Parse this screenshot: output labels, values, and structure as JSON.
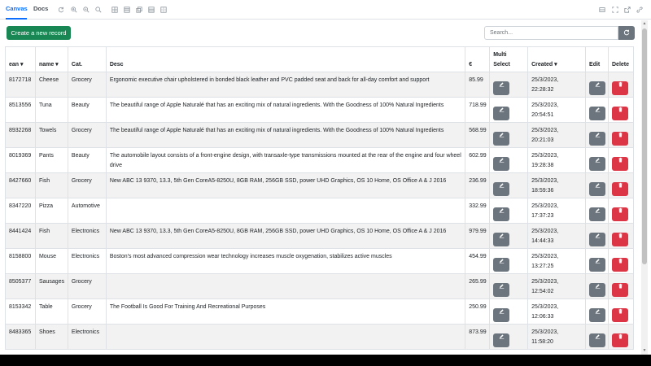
{
  "tabs": [
    {
      "label": "Canvas"
    },
    {
      "label": "Docs"
    }
  ],
  "toolbar": {
    "icons": [
      "refresh-icon",
      "zoom-in-icon",
      "zoom-out-icon",
      "zoom-reset-icon",
      "table-icon",
      "list-icon",
      "stack-icon",
      "layout-icon",
      "grid-icon",
      "panel-icon",
      "fullscreen-icon",
      "external-icon",
      "link-icon"
    ]
  },
  "actions": {
    "create_label": "Create a new record",
    "search_placeholder": "Search..."
  },
  "table": {
    "headers": {
      "ean": "ean ▾",
      "name": "name ▾",
      "cat": "Cat.",
      "desc": "Desc",
      "price": "€",
      "multi_line1": "Multi",
      "multi_line2": "Select",
      "created": "Created ▾",
      "edit": "Edit",
      "delete": "Delete"
    },
    "rows": [
      {
        "ean": "8172718",
        "name": "Cheese",
        "cat": "Grocery",
        "desc": "Ergonomic executive chair upholstered in bonded black leather and PVC padded seat and back for all-day comfort and support",
        "price": "85.99",
        "date": "25/3/2023,",
        "time": "22:28:32"
      },
      {
        "ean": "8513556",
        "name": "Tuna",
        "cat": "Beauty",
        "desc": "The beautiful range of Apple Naturalé that has an exciting mix of natural ingredients. With the Goodness of 100% Natural Ingredients",
        "price": "718.99",
        "date": "25/3/2023,",
        "time": "20:54:51"
      },
      {
        "ean": "8932268",
        "name": "Towels",
        "cat": "Grocery",
        "desc": "The beautiful range of Apple Naturalé that has an exciting mix of natural ingredients. With the Goodness of 100% Natural Ingredients",
        "price": "568.99",
        "date": "25/3/2023,",
        "time": "20:21:03"
      },
      {
        "ean": "8019369",
        "name": "Pants",
        "cat": "Beauty",
        "desc": "The automobile layout consists of a front-engine design, with transaxle-type transmissions mounted at the rear of the engine and four wheel drive",
        "price": "602.99",
        "date": "25/3/2023,",
        "time": "19:28:38"
      },
      {
        "ean": "8427660",
        "name": "Fish",
        "cat": "Grocery",
        "desc": "New ABC 13 9370, 13.3, 5th Gen CoreA5-8250U, 8GB RAM, 256GB SSD, power UHD Graphics, OS 10 Home, OS Office A & J 2016",
        "price": "236.99",
        "date": "25/3/2023,",
        "time": "18:59:36"
      },
      {
        "ean": "8347220",
        "name": "Pizza",
        "cat": "Automotive",
        "desc": "",
        "price": "332.99",
        "date": "25/3/2023,",
        "time": "17:37:23"
      },
      {
        "ean": "8441424",
        "name": "Fish",
        "cat": "Electronics",
        "desc": "New ABC 13 9370, 13.3, 5th Gen CoreA5-8250U, 8GB RAM, 256GB SSD, power UHD Graphics, OS 10 Home, OS Office A & J 2016",
        "price": "979.99",
        "date": "25/3/2023,",
        "time": "14:44:33"
      },
      {
        "ean": "8158800",
        "name": "Mouse",
        "cat": "Electronics",
        "desc": "Boston's most advanced compression wear technology increases muscle oxygenation, stabilizes active muscles",
        "price": "454.99",
        "date": "25/3/2023,",
        "time": "13:27:25"
      },
      {
        "ean": "8505377",
        "name": "Sausages",
        "cat": "Grocery",
        "desc": "",
        "price": "265.99",
        "date": "25/3/2023,",
        "time": "12:54:02"
      },
      {
        "ean": "8153342",
        "name": "Table",
        "cat": "Grocery",
        "desc": "The Football Is Good For Training And Recreational Purposes",
        "price": "250.99",
        "date": "25/3/2023,",
        "time": "12:06:33"
      },
      {
        "ean": "8483365",
        "name": "Shoes",
        "cat": "Electronics",
        "desc": "",
        "price": "873.99",
        "date": "25/3/2023,",
        "time": "11:58:20"
      }
    ]
  },
  "colors": {
    "primary": "#0d6efd",
    "create": "#198754",
    "edit": "#6c757d",
    "delete": "#dc3545"
  }
}
